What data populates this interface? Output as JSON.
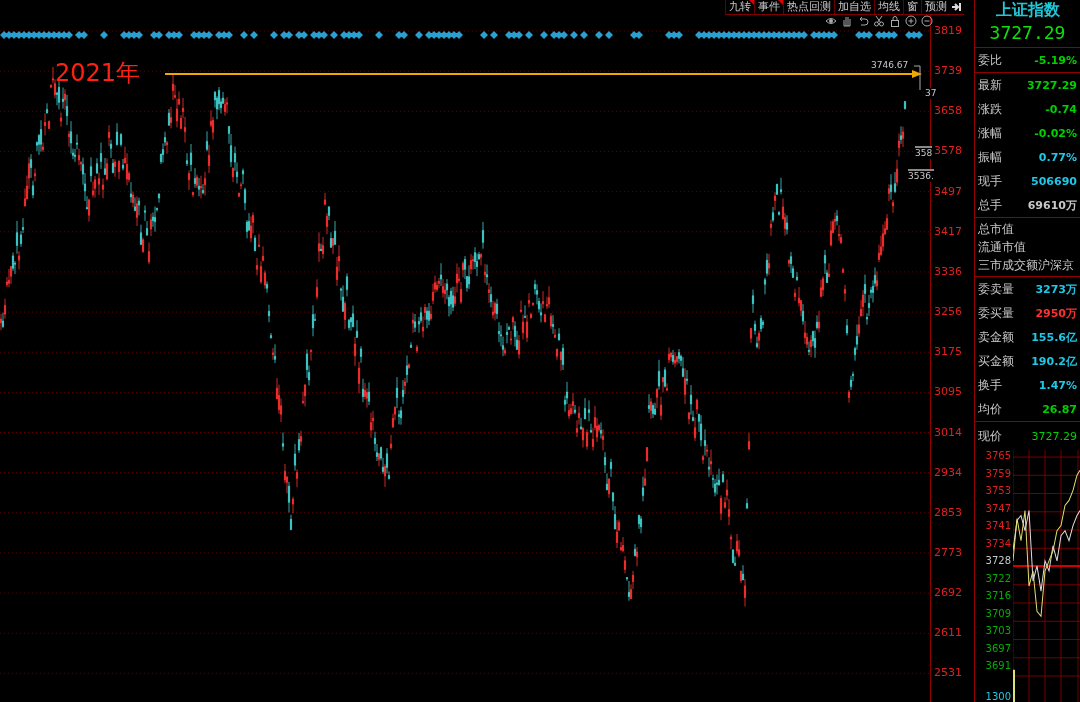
{
  "toolbar": {
    "tabs": [
      {
        "label": "九转",
        "flagged": true
      },
      {
        "label": "事件",
        "flagged": true
      },
      {
        "label": "热点回测",
        "flagged": false
      },
      {
        "label": "加自选",
        "flagged": false
      },
      {
        "label": "均线",
        "flagged": false
      },
      {
        "label": "窗",
        "flagged": false
      },
      {
        "label": "预测",
        "flagged": false
      }
    ]
  },
  "chart": {
    "annotation": "2021年",
    "high_label": "3746.67",
    "price_tags": [
      "37",
      "358",
      "3536."
    ],
    "y_axis_labels": [
      "3819",
      "3739",
      "3658",
      "3578",
      "3497",
      "3417",
      "3336",
      "3256",
      "3175",
      "3095",
      "3014",
      "2934",
      "2853",
      "2773",
      "2692",
      "2611",
      "2531"
    ]
  },
  "quote": {
    "title": "上证指数",
    "price": "3727.29",
    "rows": [
      {
        "label": "委比",
        "value": "-5.19%",
        "color": "#00d000"
      },
      {
        "label": "最新",
        "value": "3727.29",
        "color": "#00d000"
      },
      {
        "label": "涨跌",
        "value": "-0.74",
        "color": "#00d000"
      },
      {
        "label": "涨幅",
        "value": "-0.02%",
        "color": "#00d000"
      },
      {
        "label": "振幅",
        "value": "0.77%",
        "color": "#1ec8e8"
      },
      {
        "label": "现手",
        "value": "506690",
        "color": "#1ec8e8"
      },
      {
        "label": "总手",
        "value": "69610万",
        "color": "#c8c8c8"
      }
    ],
    "plain_rows": [
      "总市值",
      "流通市值",
      "三市成交额沪深京"
    ],
    "order_rows": [
      {
        "label": "委卖量",
        "value": "3273万",
        "color": "#1ec8e8"
      },
      {
        "label": "委买量",
        "value": "2950万",
        "color": "#ff3030"
      },
      {
        "label": "卖金额",
        "value": "155.6亿",
        "color": "#1ec8e8"
      },
      {
        "label": "买金额",
        "value": "190.2亿",
        "color": "#1ec8e8"
      },
      {
        "label": "换手",
        "value": "1.47%",
        "color": "#1ec8e8"
      },
      {
        "label": "均价",
        "value": "26.87",
        "color": "#00d000"
      }
    ],
    "current": {
      "label": "现价",
      "value": "3727.29",
      "color": "#00d000"
    },
    "mini_axis": [
      {
        "label": "3765",
        "color": "#e02020"
      },
      {
        "label": "3759",
        "color": "#e02020"
      },
      {
        "label": "3753",
        "color": "#e02020"
      },
      {
        "label": "3747",
        "color": "#e02020"
      },
      {
        "label": "3741",
        "color": "#e02020"
      },
      {
        "label": "3734",
        "color": "#e02020"
      },
      {
        "label": "3728",
        "color": "#c8c8c8"
      },
      {
        "label": "3722",
        "color": "#00b000"
      },
      {
        "label": "3716",
        "color": "#00b000"
      },
      {
        "label": "3709",
        "color": "#00b000"
      },
      {
        "label": "3703",
        "color": "#00b000"
      },
      {
        "label": "3697",
        "color": "#00b000"
      },
      {
        "label": "3691",
        "color": "#00b000"
      },
      {
        "label": "1300",
        "color": "#1ec8e8"
      }
    ]
  }
}
